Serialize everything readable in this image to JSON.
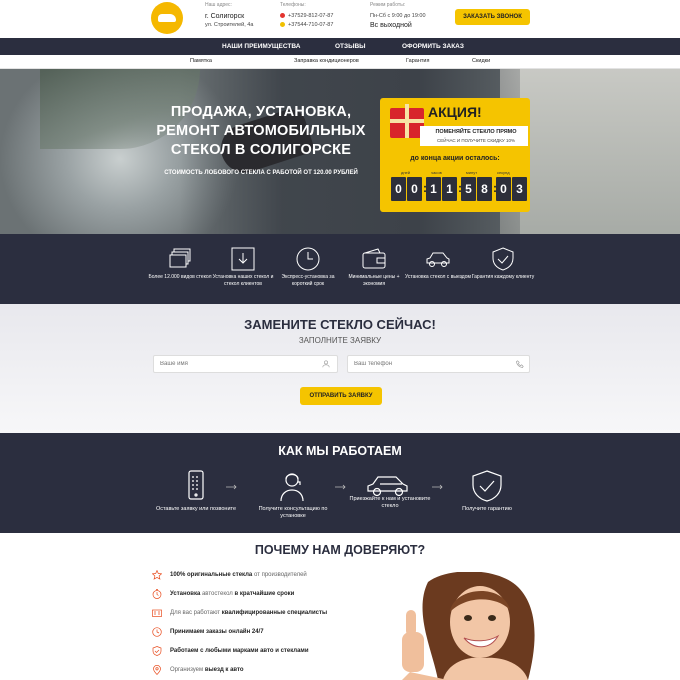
{
  "header": {
    "address_caption": "Наш адрес:",
    "address_city": "г. Солигорск",
    "address_street": "ул. Строителей, 4а",
    "phones_caption": "Телефоны:",
    "phone1": "+37529-812-07-87",
    "phone2": "+37544-710-07-87",
    "hours_caption": "Режим работы:",
    "hours_weekdays": "Пн-Сб с 9:00 до 19:00",
    "hours_weekend": "Вс выходной",
    "call_button": "ЗАКАЗАТЬ ЗВОНОК",
    "accent_color": "#f5c400"
  },
  "nav_main": [
    "НАШИ ПРЕИМУЩЕСТВА",
    "ОТЗЫВЫ",
    "ОФОРМИТЬ ЗАКАЗ"
  ],
  "nav_sub": [
    "Памятка",
    "Заправка кондиционеров",
    "Гарантия",
    "Скидки"
  ],
  "hero": {
    "title": "ПРОДАЖА, УСТАНОВКА, РЕМОНТ АВТОМОБИЛЬНЫХ СТЕКОЛ В СОЛИГОРСКЕ",
    "subtitle": "СТОИМОСТЬ ЛОБОВОГО СТЕКЛА С РАБОТОЙ ОТ 120.00 РУБЛЕЙ"
  },
  "promo": {
    "title": "АКЦИЯ!",
    "line1": "ПОМЕНЯЙТЕ СТЕКЛО ПРЯМО",
    "line2": "СЕЙЧАС И ПОЛУЧИТЕ СКИДКУ 10%",
    "until": "до конца акции осталось:",
    "labels": [
      "дней",
      "часов",
      "минут",
      "секунд"
    ],
    "digits": [
      "0",
      "0",
      "1",
      "1",
      "5",
      "8",
      "0",
      "3"
    ]
  },
  "features": [
    {
      "icon": "windshields-icon",
      "text": "Более 12.000 видов стекол"
    },
    {
      "icon": "download-box-icon",
      "text": "Установка наших стекол и стекол клиентов"
    },
    {
      "icon": "clock-icon",
      "text": "Экспресс-установка за короткий срок"
    },
    {
      "icon": "wallet-icon",
      "text": "Минимальные цены + экономия"
    },
    {
      "icon": "car-icon",
      "text": "Установка стекол с выездом"
    },
    {
      "icon": "shield-check-icon",
      "text": "Гарантия каждому клиенту"
    }
  ],
  "form": {
    "title": "ЗАМЕНИТЕ СТЕКЛО СЕЙЧАС!",
    "subtitle": "ЗАПОЛНИТЕ ЗАЯВКУ",
    "name_placeholder": "Ваше имя",
    "phone_placeholder": "Ваш телефон",
    "submit": "ОТПРАВИТЬ ЗАЯВКУ"
  },
  "how": {
    "title": "КАК МЫ РАБОТАЕМ",
    "steps": [
      {
        "icon": "phone-icon",
        "text": "Оставьте заявку или позвоните"
      },
      {
        "icon": "consultant-icon",
        "text": "Получите консультацию по установке"
      },
      {
        "icon": "car-icon",
        "text": "Приезжайте к нам и установите стекло"
      },
      {
        "icon": "shield-check-icon",
        "text": "Получите гарантию"
      }
    ]
  },
  "trust": {
    "title": "ПОЧЕМУ НАМ ДОВЕРЯЮТ?",
    "items": [
      {
        "icon": "star-icon",
        "bold": "100% оригинальные стекла",
        "light": " от производителей",
        "pre": ""
      },
      {
        "icon": "stopwatch-icon",
        "bold": "Установка",
        "light": " автостекол ",
        "post": "в кратчайшие сроки"
      },
      {
        "icon": "id-card-icon",
        "pre": "Для вас работают ",
        "bold": "квалифицированные специалисты",
        "light": ""
      },
      {
        "icon": "clock-24-icon",
        "bold": "Принимаем заказы онлайн 24/7",
        "light": ""
      },
      {
        "icon": "car-shield-icon",
        "bold": "Работаем с любыми марками авто и стеклами",
        "light": ""
      },
      {
        "icon": "map-pin-icon",
        "pre": "Организуем ",
        "bold": "выезд к авто",
        "light": ""
      }
    ]
  }
}
